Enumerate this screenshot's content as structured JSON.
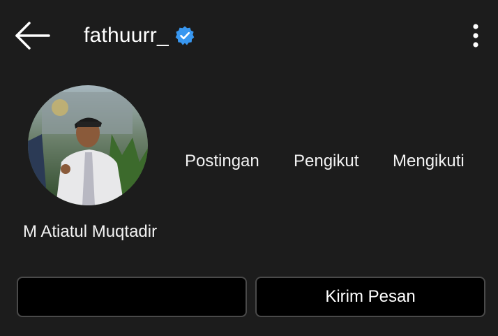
{
  "header": {
    "username": "fathuurr_",
    "back_icon": "arrow-left-icon",
    "verified_icon": "verified-badge-icon",
    "more_icon": "more-vertical-icon"
  },
  "profile": {
    "full_name": "M Atiatul Muqtadir",
    "stats": {
      "posts_label": "Postingan",
      "followers_label": "Pengikut",
      "following_label": "Mengikuti"
    }
  },
  "actions": {
    "primary_label": "",
    "message_label": "Kirim Pesan"
  },
  "colors": {
    "background": "#1c1c1c",
    "verified": "#3897f0",
    "button_bg": "#000000",
    "button_border": "#4a4a4a"
  }
}
